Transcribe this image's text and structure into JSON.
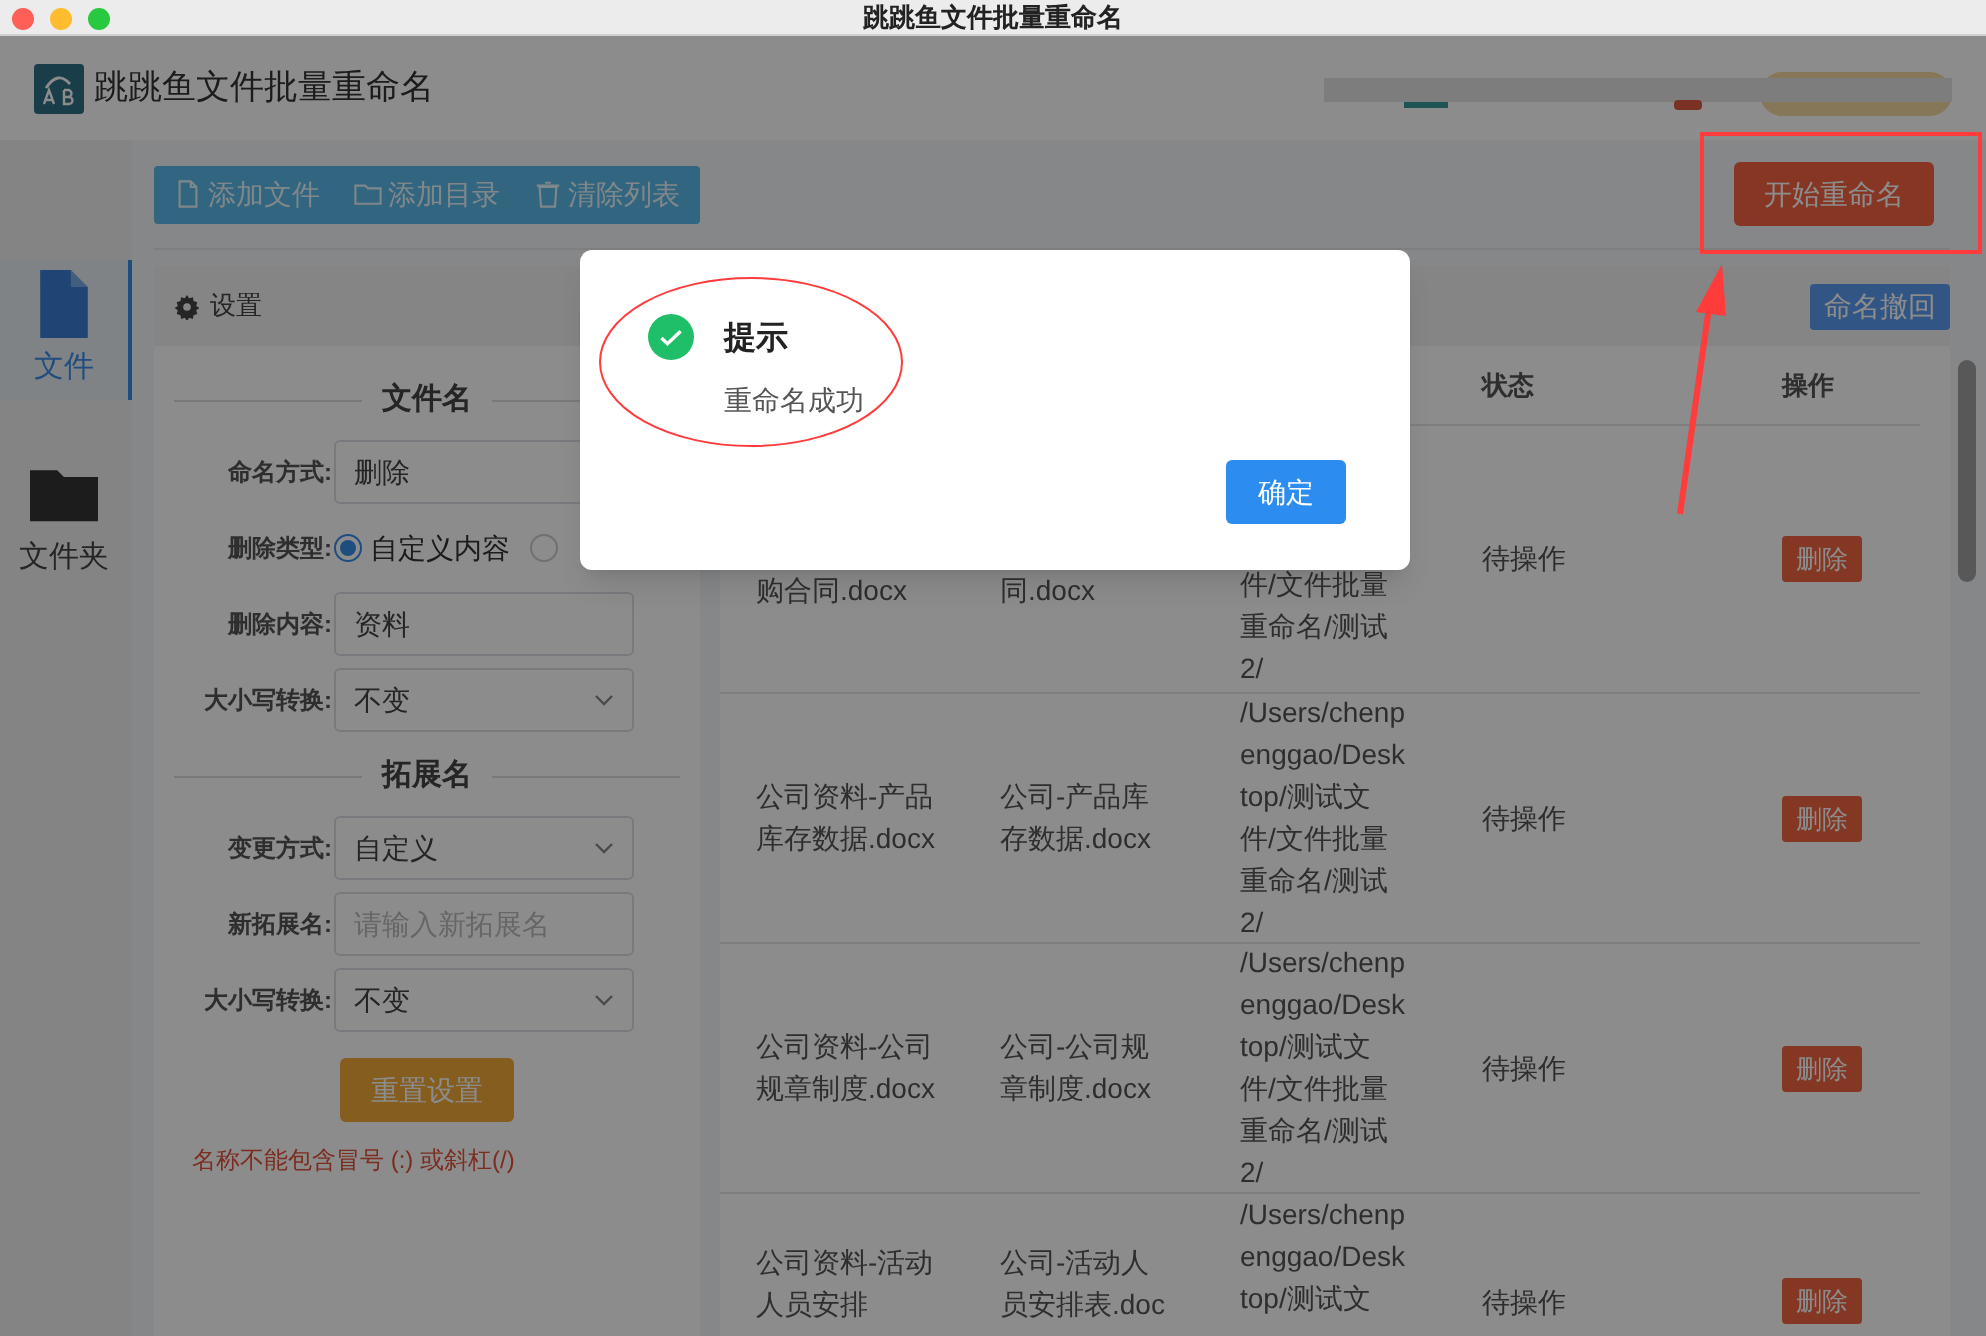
{
  "window": {
    "title": "跳跳鱼文件批量重命名"
  },
  "app": {
    "title": "跳跳鱼文件批量重命名"
  },
  "sidebar": {
    "items": [
      {
        "label": "文件",
        "selected": true
      },
      {
        "label": "文件夹",
        "selected": false
      }
    ]
  },
  "toolbar": {
    "buttons": [
      {
        "label": "添加文件"
      },
      {
        "label": "添加目录"
      },
      {
        "label": "清除列表"
      }
    ],
    "start_button": "开始重命名"
  },
  "settings": {
    "title": "设置",
    "sections": [
      {
        "title": "文件名",
        "fields": [
          {
            "kind": "input",
            "label": "命名方式:",
            "value": "删除"
          },
          {
            "kind": "radio",
            "label": "删除类型:",
            "options": [
              {
                "label": "自定义内容",
                "selected": true
              },
              {
                "selected": false
              }
            ]
          },
          {
            "kind": "input",
            "label": "删除内容:",
            "value": "资料"
          },
          {
            "kind": "select",
            "label": "大小写转换:",
            "value": "不变"
          }
        ]
      },
      {
        "title": "拓展名",
        "fields": [
          {
            "kind": "select",
            "label": "变更方式:",
            "value": "自定义"
          },
          {
            "kind": "input",
            "label": "新拓展名:",
            "placeholder": "请输入新拓展名"
          },
          {
            "kind": "select",
            "label": "大小写转换:",
            "value": "不变"
          }
        ]
      }
    ],
    "reset_button": "重置设置",
    "note": "名称不能包含冒号 (:) 或斜杠(/)"
  },
  "table": {
    "undo_button": "命名撤回",
    "columns": [
      "状态",
      "操作"
    ],
    "rows": [
      {
        "original": "购合同.docx",
        "new": "同.docx",
        "path": "件/文件批量重命名/测试2/",
        "status": "待操作",
        "action": "删除"
      },
      {
        "original": "公司资料-产品库存数据.docx",
        "new": "公司-产品库存数据.docx",
        "path": "/Users/chenpenggao/Desktop/测试文件/文件批量重命名/测试2/",
        "status": "待操作",
        "action": "删除"
      },
      {
        "original": "公司资料-公司规章制度.docx",
        "new": "公司-公司规章制度.docx",
        "path": "/Users/chenpenggao/Desktop/测试文件/文件批量重命名/测试2/",
        "status": "待操作",
        "action": "删除"
      },
      {
        "original": "公司资料-活动人员安排",
        "new": "公司-活动人员安排表.doc",
        "path": "/Users/chenpenggao/Desktop/测试文",
        "status": "待操作",
        "action": "删除"
      }
    ]
  },
  "dialog": {
    "title": "提示",
    "message": "重命名成功",
    "ok_button": "确定"
  }
}
